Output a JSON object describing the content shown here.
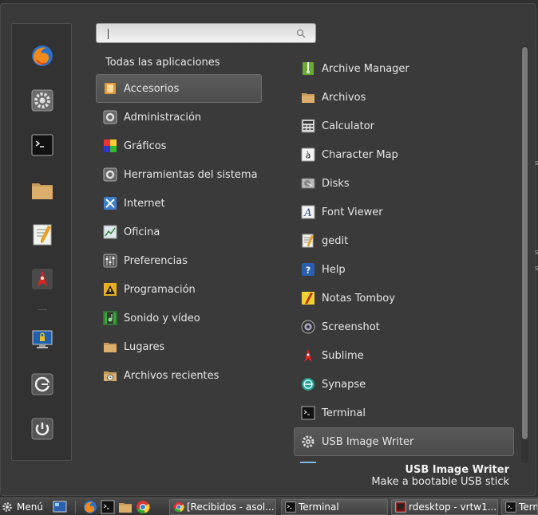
{
  "search": {
    "value": "",
    "placeholder": ""
  },
  "categories_header": "Todas las aplicaciones",
  "categories": [
    {
      "label": "Accesorios",
      "icon": "accessories-icon",
      "selected": true
    },
    {
      "label": "Administración",
      "icon": "administration-icon"
    },
    {
      "label": "Gráficos",
      "icon": "graphics-icon"
    },
    {
      "label": "Herramientas del sistema",
      "icon": "system-tools-icon"
    },
    {
      "label": "Internet",
      "icon": "internet-icon"
    },
    {
      "label": "Oficina",
      "icon": "office-icon"
    },
    {
      "label": "Preferencias",
      "icon": "preferences-icon"
    },
    {
      "label": "Programación",
      "icon": "programming-icon"
    },
    {
      "label": "Sonido y vídeo",
      "icon": "sound-video-icon"
    },
    {
      "label": "Lugares",
      "icon": "places-folder-icon"
    },
    {
      "label": "Archivos recientes",
      "icon": "recent-files-icon"
    }
  ],
  "apps": [
    {
      "label": "Archive Manager",
      "icon": "archive-manager-icon"
    },
    {
      "label": "Archivos",
      "icon": "folder-icon"
    },
    {
      "label": "Calculator",
      "icon": "calculator-icon"
    },
    {
      "label": "Character Map",
      "icon": "character-map-icon"
    },
    {
      "label": "Disks",
      "icon": "disks-icon"
    },
    {
      "label": "Font Viewer",
      "icon": "font-viewer-icon"
    },
    {
      "label": "gedit",
      "icon": "gedit-icon"
    },
    {
      "label": "Help",
      "icon": "help-icon"
    },
    {
      "label": "Notas Tomboy",
      "icon": "tomboy-icon"
    },
    {
      "label": "Screenshot",
      "icon": "screenshot-icon"
    },
    {
      "label": "Sublime",
      "icon": "sublime-icon"
    },
    {
      "label": "Synapse",
      "icon": "synapse-icon"
    },
    {
      "label": "Terminal",
      "icon": "terminal-icon"
    },
    {
      "label": "USB Image Writer",
      "icon": "usb-writer-icon",
      "selected": true
    }
  ],
  "description": {
    "title": "USB Image Writer",
    "text": "Make a bootable USB stick"
  },
  "favorites": [
    {
      "name": "firefox-icon"
    },
    {
      "name": "settings-icon"
    },
    {
      "name": "terminal-icon"
    },
    {
      "name": "folder-icon"
    },
    {
      "name": "text-editor-icon"
    },
    {
      "name": "sublime-icon"
    },
    {
      "name": "lock-screen-icon"
    },
    {
      "name": "logout-icon"
    },
    {
      "name": "power-icon"
    }
  ],
  "panel": {
    "menu_label": "Menú",
    "tasks": [
      {
        "label": "[Recibidos - asol...",
        "icon": "chrome-icon"
      },
      {
        "label": "Terminal",
        "icon": "terminal-icon"
      },
      {
        "label": "rdesktop - vrtw1...",
        "icon": "rdesktop-icon"
      },
      {
        "label": "Term",
        "icon": "terminal-icon"
      }
    ]
  },
  "edge_marks": [
    "s",
    "s",
    "s"
  ],
  "colors": {
    "menu_bg": "#3a3a3a",
    "selected_bg": "#555555",
    "panel_bg": "#3d3d3d",
    "text": "#e6e6e6"
  }
}
